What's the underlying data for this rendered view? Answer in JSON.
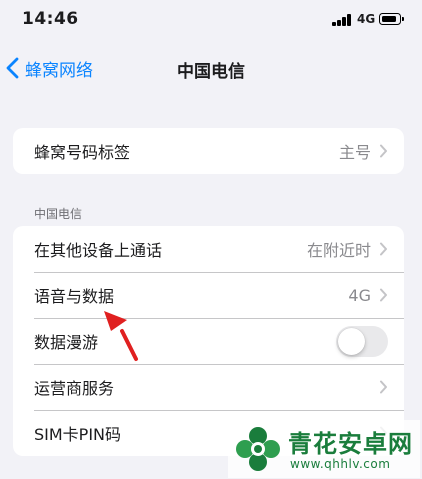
{
  "status_bar": {
    "time": "14:46",
    "network": "4G"
  },
  "nav": {
    "back_label": "蜂窝网络",
    "title": "中国电信"
  },
  "group1": {
    "rows": [
      {
        "label": "蜂窝号码标签",
        "value": "主号"
      }
    ]
  },
  "section_header": "中国电信",
  "group2": {
    "rows": [
      {
        "label": "在其他设备上通话",
        "value": "在附近时"
      },
      {
        "label": "语音与数据",
        "value": "4G"
      },
      {
        "label": "数据漫游",
        "toggle_on": false
      },
      {
        "label": "运营商服务"
      },
      {
        "label": "SIM卡PIN码"
      }
    ]
  },
  "watermark": {
    "name": "青花安卓网",
    "url": "www.qhhlv.com"
  },
  "colors": {
    "accent": "#0a84ff",
    "background": "#f2f2f7",
    "arrow": "#e02020",
    "watermark": "#1a7d3c"
  }
}
